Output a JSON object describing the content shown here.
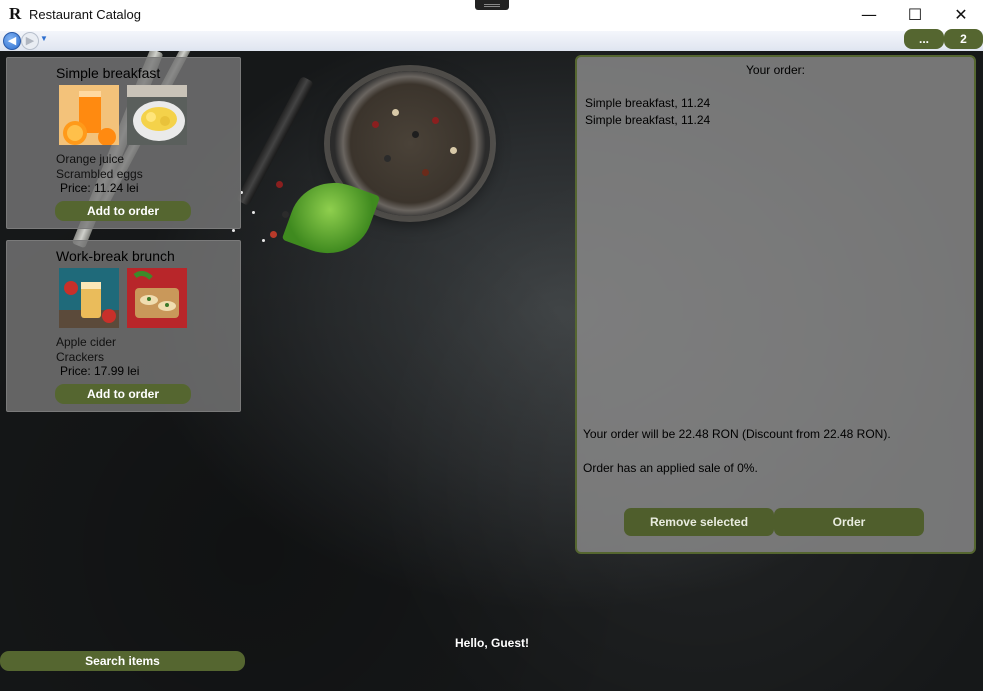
{
  "window": {
    "logo": "R",
    "title": "Restaurant Catalog",
    "controls": {
      "minimize": "—",
      "maximize": "☐",
      "close": "✕"
    }
  },
  "nav": {
    "back_icon": "back-arrow-icon",
    "forward_icon": "forward-arrow-icon",
    "menu_button": "...",
    "count_button": "2"
  },
  "menu": [
    {
      "title": "Simple breakfast",
      "items": [
        "Orange juice",
        "Scrambled eggs"
      ],
      "price": "Price: 11.24 lei",
      "button": "Add to order",
      "images": [
        "orange-juice-image",
        "scrambled-eggs-image"
      ]
    },
    {
      "title": "Work-break brunch",
      "items": [
        "Apple cider",
        "Crackers"
      ],
      "price": "Price: 17.99 lei",
      "button": "Add to order",
      "images": [
        "apple-cider-image",
        "crackers-image"
      ]
    }
  ],
  "order": {
    "title": "Your order:",
    "items": [
      "Simple breakfast, 11.24",
      "Simple breakfast, 11.24"
    ],
    "summary": "Your order will be 22.48 RON (Discount from 22.48 RON).",
    "sale": "Order has an applied sale of 0%.",
    "remove_button": "Remove selected",
    "order_button": "Order"
  },
  "greeting": "Hello, Guest!",
  "search_button": "Search items",
  "colors": {
    "accent": "#556630",
    "panel": "#878787",
    "background": "#2a2d2f"
  }
}
